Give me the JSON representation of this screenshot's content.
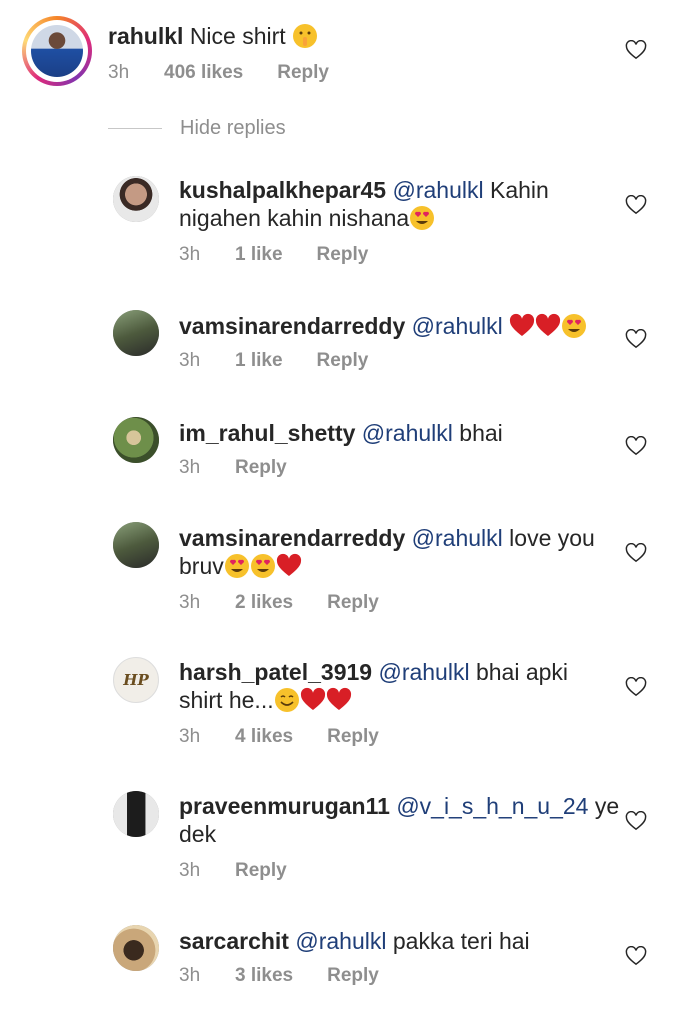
{
  "main_comment": {
    "username": "rahulkl",
    "text": "Nice shirt",
    "emoji": "shushing-face",
    "time": "3h",
    "likes": "406 likes",
    "reply": "Reply"
  },
  "hide_replies": "Hide replies",
  "replies": [
    {
      "username": "kushalpalkhepar45",
      "mention": "@rahulkl",
      "text": " Kahin",
      "text2": "nigahen kahin nishana",
      "emojis": [
        "heart-eyes"
      ],
      "time": "3h",
      "likes": "1 like",
      "reply": "Reply"
    },
    {
      "username": "vamsinarendarreddy",
      "mention": "@rahulkl",
      "text": "",
      "emojis": [
        "red-heart",
        "red-heart",
        "heart-eyes"
      ],
      "time": "3h",
      "likes": "1 like",
      "reply": "Reply"
    },
    {
      "username": "im_rahul_shetty",
      "mention": "@rahulkl",
      "text": " bhai",
      "emojis": [],
      "time": "3h",
      "likes": "",
      "reply": "Reply"
    },
    {
      "username": "vamsinarendarreddy",
      "mention": "@rahulkl",
      "text": " love you",
      "text2": "bruv",
      "emojis": [
        "heart-eyes",
        "heart-eyes",
        "red-heart"
      ],
      "time": "3h",
      "likes": "2 likes",
      "reply": "Reply"
    },
    {
      "username": "harsh_patel_3919",
      "mention": "@rahulkl",
      "text": " bhai apki",
      "text2": "shirt he...",
      "emojis": [
        "smiling-face",
        "red-heart",
        "red-heart"
      ],
      "time": "3h",
      "likes": "4 likes",
      "reply": "Reply"
    },
    {
      "username": "praveenmurugan11",
      "mention": "@v_i_s_h_n_u_24",
      "text": " ye",
      "text2": "dek",
      "emojis": [],
      "time": "3h",
      "likes": "",
      "reply": "Reply"
    },
    {
      "username": "sarcarchit",
      "mention": "@rahulkl",
      "text": " pakka teri hai",
      "emojis": [],
      "time": "3h",
      "likes": "3 likes",
      "reply": "Reply"
    }
  ],
  "avatar_badges": {
    "harsh": "HP"
  }
}
